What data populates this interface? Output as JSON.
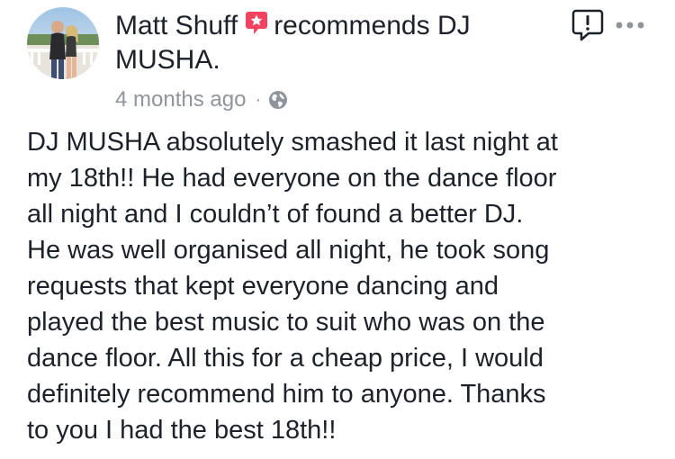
{
  "review": {
    "author": "Matt Shuff",
    "verb": "recommends",
    "page": "DJ MUSHA.",
    "timestamp": "4 months ago",
    "separator": "·",
    "privacy_icon": "globe-icon",
    "badge_icon": "recommendation-star-icon",
    "report_icon": "report-icon",
    "more_icon": "more-options-icon",
    "text": "DJ MUSHA absolutely smashed it last night at\nmy 18th!! He had everyone on the dance floor\nall night and I couldn’t of found a better DJ.\nHe was well organised all night, he took song\nrequests that kept everyone dancing and\nplayed the best music to suit who was on the\ndance floor. All this for a cheap price, I would\ndefinitely recommend him to anyone. Thanks\nto you I had the best 18th!!"
  },
  "colors": {
    "text": "#1d2129",
    "meta": "#90949c",
    "badge": "#f3425f",
    "icon": "#1d2129"
  }
}
